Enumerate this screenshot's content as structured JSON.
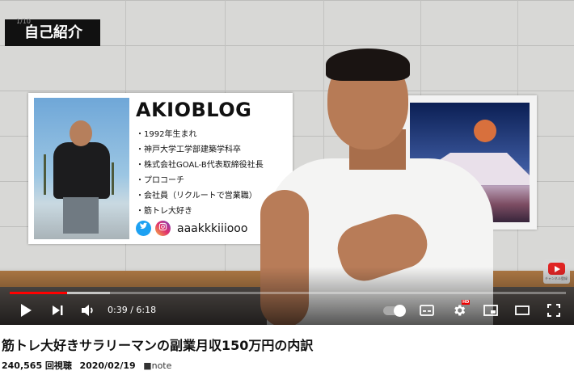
{
  "video": {
    "overlay_tag": "自己紹介",
    "overlay_tag_small": "1/10",
    "card": {
      "title": "AKIOBLOG",
      "items": [
        "・1992年生まれ",
        "・神戸大学工学部建築学科卒",
        "・株式会社GOAL-B代表取締役社長",
        "・プロコーチ",
        "・会社員（リクルートで営業職）",
        "・筋トレ大好き"
      ],
      "twitter_icon": "twitter-icon",
      "instagram_icon": "instagram-icon",
      "handle": "aaakkkiiiooo"
    },
    "channel_badge_text": "チャンネル登録",
    "player": {
      "current_time": "0:39",
      "duration": "6:18",
      "time_label": "0:39 / 6:18",
      "progress_fraction": 0.103,
      "buffered_fraction": 0.18,
      "accent": "#ff0000",
      "settings_badge": "HD",
      "icons": [
        "play-icon",
        "next-icon",
        "volume-icon",
        "autoplay-toggle",
        "subtitles-icon",
        "settings-icon",
        "miniplayer-icon",
        "theater-icon",
        "fullscreen-icon"
      ]
    }
  },
  "info": {
    "title": "筋トレ大好きサラリーマンの副業月収150万円の内訳",
    "views": "240,565 回視聴",
    "date": "2020/02/19",
    "tag": "■note"
  }
}
